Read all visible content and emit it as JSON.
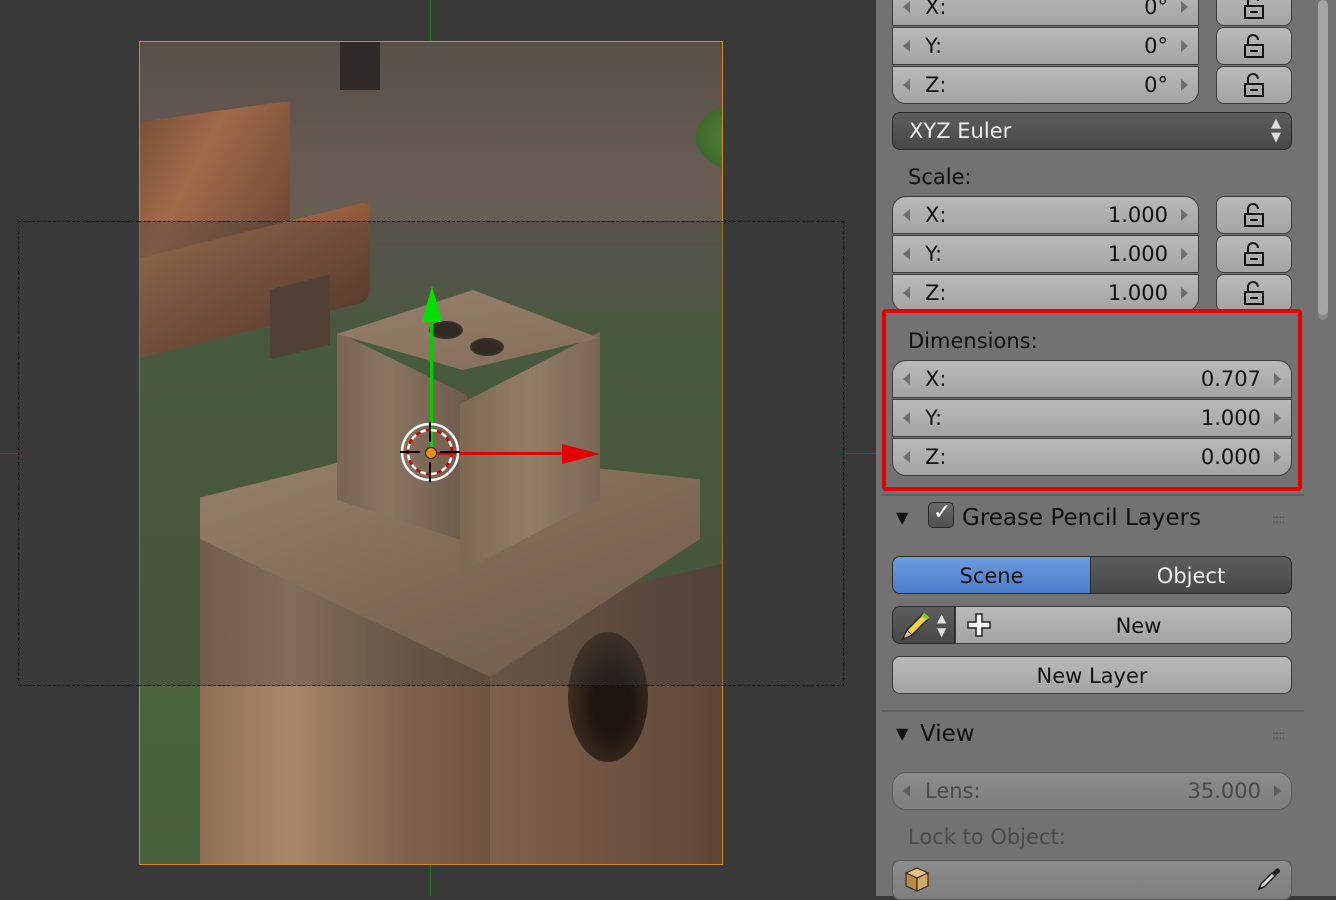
{
  "rotation": {
    "x": {
      "label": "X:",
      "value": "0°"
    },
    "y": {
      "label": "Y:",
      "value": "0°"
    },
    "z": {
      "label": "Z:",
      "value": "0°"
    },
    "mode": "XYZ Euler"
  },
  "scale": {
    "title": "Scale:",
    "x": {
      "label": "X:",
      "value": "1.000"
    },
    "y": {
      "label": "Y:",
      "value": "1.000"
    },
    "z": {
      "label": "Z:",
      "value": "1.000"
    }
  },
  "dimensions": {
    "title": "Dimensions:",
    "x": {
      "label": "X:",
      "value": "0.707"
    },
    "y": {
      "label": "Y:",
      "value": "1.000"
    },
    "z": {
      "label": "Z:",
      "value": "0.000"
    }
  },
  "grease_pencil": {
    "title": "Grease Pencil Layers",
    "enabled": true,
    "tabs": [
      "Scene",
      "Object"
    ],
    "active_tab": "Scene",
    "new_label": "New",
    "new_layer_label": "New Layer"
  },
  "view": {
    "title": "View",
    "lens": {
      "label": "Lens:",
      "value": "35.000"
    },
    "lock_to_object_label": "Lock to Object:"
  },
  "icons": {
    "lock": "unlock-icon",
    "pencil": "pencil-icon",
    "plus": "plus-icon",
    "cube": "cube-icon",
    "eyedropper": "eyedropper-icon"
  },
  "colors": {
    "highlight": "#e60000",
    "active_tab": "#5a88d4",
    "x_axis": "#e00000",
    "y_axis": "#00d000",
    "camera_frame": "#d18a1a"
  }
}
